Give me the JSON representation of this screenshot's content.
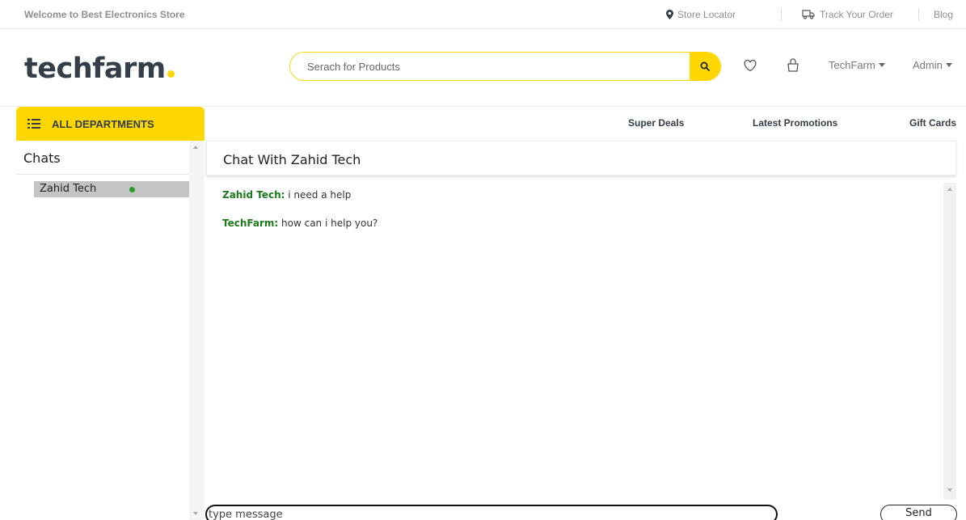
{
  "topbar": {
    "welcome": "Welcome to Best Electronics Store",
    "store_locator": "Store Locator",
    "track_order": "Track Your Order",
    "blog": "Blog"
  },
  "header": {
    "logo": "techfarm",
    "search_placeholder": "Serach for Products",
    "account_menu": "TechFarm",
    "admin_menu": "Admin"
  },
  "nav": {
    "departments": "ALL DEPARTMENTS",
    "links": [
      "Super Deals",
      "Latest Promotions",
      "Gift Cards"
    ]
  },
  "sidebar": {
    "title": "Chats",
    "contacts": [
      {
        "name": "Zahid Tech",
        "status": "online"
      }
    ]
  },
  "chat": {
    "title": "Chat With Zahid Tech",
    "messages": [
      {
        "sender": "Zahid Tech:",
        "text": "i need a help"
      },
      {
        "sender": "TechFarm:",
        "text": "how can i help you?"
      }
    ],
    "input_placeholder": "type message",
    "send_label": "Send"
  },
  "colors": {
    "accent": "#fed700",
    "sender": "#1b7a1b",
    "online": "#2a9c2a"
  }
}
